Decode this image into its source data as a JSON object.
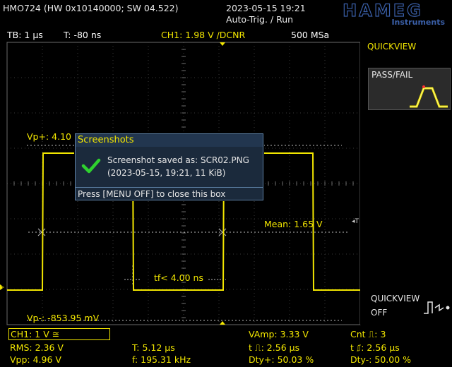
{
  "header": {
    "model": "HMO724 (HW 0x10140000; SW 04.522)",
    "datetime": "2023-05-15 19:21",
    "trigger_state": "Auto-Trig. / Run",
    "brand": "HAMEG",
    "brand_sub": "Instruments"
  },
  "status": {
    "timebase": "TB: 1 µs",
    "trigger_pos": "T: -80 ns",
    "channel": "CH1: 1.98 V /DCNR",
    "sample_rate": "500 MSa"
  },
  "cursors": {
    "vp_plus": "Vp+: 4.10",
    "vp_minus": "Vp-: -853.95 mV",
    "mean": "Mean: 1.65 V",
    "fall_time": "tf< 4.00 ns"
  },
  "popup": {
    "title": "Screenshots",
    "line1": "Screenshot saved as: SCR02.PNG",
    "line2": "(2023-05-15, 19:21, 11 KiB)",
    "footer": "Press [MENU OFF] to close this box"
  },
  "side": {
    "quickview": "QUICKVIEW",
    "passfail": "PASS/FAIL",
    "quickview_off_label": "QUICKVIEW",
    "quickview_off_state": "OFF"
  },
  "bottom": {
    "ch1": "CH1: 1 V ≅",
    "rms": "RMS: 2.36 V",
    "vpp": "Vpp: 4.96 V",
    "period": "T: 5.12 µs",
    "freq": "f: 195.31 kHz",
    "vamp": "VAmp: 3.33 V",
    "pulse_pos": "t ⎍: 2.56 µs",
    "duty_pos": "Dty+: 50.03 %",
    "count_rise": "Cnt ⎍: 3",
    "pulse_neg": "t ⎎: 2.56 µs",
    "duty_neg": "Dty-: 50.00 %"
  },
  "channel_marker": "1",
  "colors": {
    "trace": "#f2e600",
    "grid": "#6a6a6a",
    "popup_bg": "#1b2a3c",
    "check": "#2fd12f",
    "brand": "#2a4a8c"
  }
}
